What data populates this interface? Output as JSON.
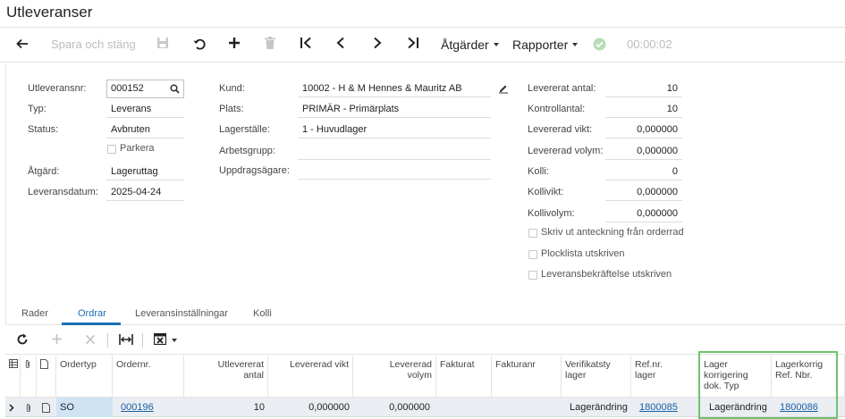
{
  "page": {
    "title": "Utleveranser"
  },
  "toolbar": {
    "save_close": "Spara och stäng",
    "actions": "Åtgärder",
    "reports": "Rapporter",
    "timer": "00:00:02"
  },
  "form": {
    "left": {
      "shipment_nbr_label": "Utleveransnr:",
      "shipment_nbr": "000152",
      "type_label": "Typ:",
      "type": "Leverans",
      "status_label": "Status:",
      "status": "Avbruten",
      "hold_label": "Parkera",
      "operation_label": "Åtgärd:",
      "operation": "Lageruttag",
      "date_label": "Leveransdatum:",
      "date": "2025-04-24"
    },
    "middle": {
      "customer_label": "Kund:",
      "customer": "10002 - H & M Hennes & Mauritz AB",
      "location_label": "Plats:",
      "location": "PRIMÄR - Primärplats",
      "warehouse_label": "Lagerställe:",
      "warehouse": "1 - Huvudlager",
      "workgroup_label": "Arbetsgrupp:",
      "workgroup": "",
      "owner_label": "Uppdragsägare:",
      "owner": ""
    },
    "right": {
      "shipped_qty_label": "Levererat antal:",
      "shipped_qty": "10",
      "control_qty_label": "Kontrollantal:",
      "control_qty": "10",
      "shipped_weight_label": "Levererad vikt:",
      "shipped_weight": "0,000000",
      "shipped_volume_label": "Levererad volym:",
      "shipped_volume": "0,000000",
      "packages_label": "Kolli:",
      "packages": "0",
      "package_weight_label": "Kollivikt:",
      "package_weight": "0,000000",
      "package_volume_label": "Kollivolym:",
      "package_volume": "0,000000",
      "print_note_label": "Skriv ut anteckning från orderrad",
      "picklist_label": "Plocklista utskriven",
      "confirmation_label": "Leveransbekräftelse utskriven"
    }
  },
  "tabs": [
    "Rader",
    "Ordrar",
    "Leveransinställningar",
    "Kolli"
  ],
  "grid": {
    "headers": {
      "order_type": "Ordertyp",
      "order_nbr": "Ordernr.",
      "shipped_qty": [
        "Utlevererat",
        "antal"
      ],
      "shipped_weight": "Levererad vikt",
      "shipped_volume": [
        "Levererad",
        "volym"
      ],
      "invoice_type": "Fakturat",
      "invoice_nbr": "Fakturanr",
      "inv_doc_type": [
        "Verifikatsty",
        "lager"
      ],
      "inv_ref_nbr": [
        "Ref.nr.",
        "lager"
      ],
      "adj_doc_type": [
        "Lager",
        "korrigering",
        "dok. Typ"
      ],
      "adj_ref_nbr": [
        "Lagerkorrig",
        "Ref. Nbr."
      ]
    },
    "rows": [
      {
        "order_type": "SO",
        "order_nbr": "000196",
        "shipped_qty": "10",
        "shipped_weight": "0,000000",
        "shipped_volume": "0,000000",
        "invoice_type": "",
        "invoice_nbr": "",
        "inv_doc_type": "Lagerändring",
        "inv_ref_nbr": "1800085",
        "adj_doc_type": "Lagerändring",
        "adj_ref_nbr": "1800086"
      }
    ]
  },
  "colors": {
    "accent": "#1a6fb7",
    "link": "#1a5fa6",
    "highlight": "#70c26c",
    "selected_row": "#eaeef2"
  }
}
